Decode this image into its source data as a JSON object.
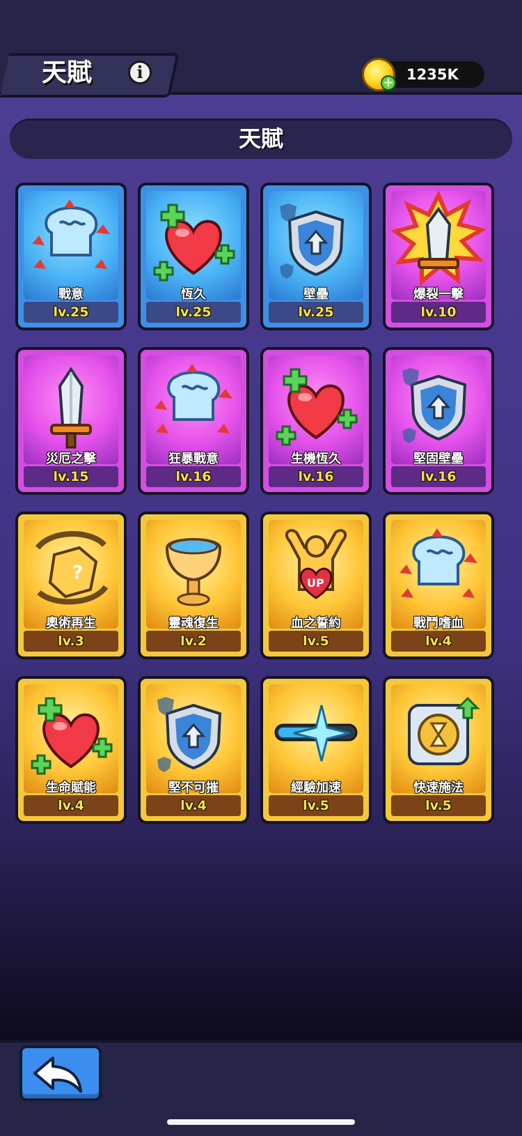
{
  "header": {
    "title": "天賦",
    "coins": "1235K"
  },
  "section": {
    "title": "天賦"
  },
  "talents": [
    {
      "name": "戰意",
      "level": "lv.25",
      "tier": "blue",
      "icon": "fist-icon"
    },
    {
      "name": "恆久",
      "level": "lv.25",
      "tier": "blue",
      "icon": "heart-icon"
    },
    {
      "name": "壁壘",
      "level": "lv.25",
      "tier": "blue",
      "icon": "shield-icon"
    },
    {
      "name": "爆裂一擊",
      "level": "lv.10",
      "tier": "purple",
      "icon": "sword-burst-icon"
    },
    {
      "name": "災厄之擊",
      "level": "lv.15",
      "tier": "purple",
      "icon": "sword-icon"
    },
    {
      "name": "狂暴戰意",
      "level": "lv.16",
      "tier": "purple",
      "icon": "fist-icon"
    },
    {
      "name": "生機恆久",
      "level": "lv.16",
      "tier": "purple",
      "icon": "heart-icon"
    },
    {
      "name": "堅固壁壘",
      "level": "lv.16",
      "tier": "purple",
      "icon": "shield-icon"
    },
    {
      "name": "奧術再生",
      "level": "lv.3",
      "tier": "gold",
      "icon": "dice-icon"
    },
    {
      "name": "靈魂復生",
      "level": "lv.2",
      "tier": "gold",
      "icon": "chalice-icon"
    },
    {
      "name": "血之誓約",
      "level": "lv.5",
      "tier": "gold",
      "icon": "strongman-up-icon"
    },
    {
      "name": "戰鬥嗜血",
      "level": "lv.4",
      "tier": "gold",
      "icon": "fist-icon"
    },
    {
      "name": "生命賦能",
      "level": "lv.4",
      "tier": "gold",
      "icon": "heart-icon"
    },
    {
      "name": "堅不可摧",
      "level": "lv.4",
      "tier": "gold",
      "icon": "shield-icon"
    },
    {
      "name": "經驗加速",
      "level": "lv.5",
      "tier": "gold",
      "icon": "sparkle-bar-icon"
    },
    {
      "name": "快速施法",
      "level": "lv.5",
      "tier": "gold",
      "icon": "hourglass-icon"
    }
  ],
  "misc": {
    "up_text": "UP"
  }
}
